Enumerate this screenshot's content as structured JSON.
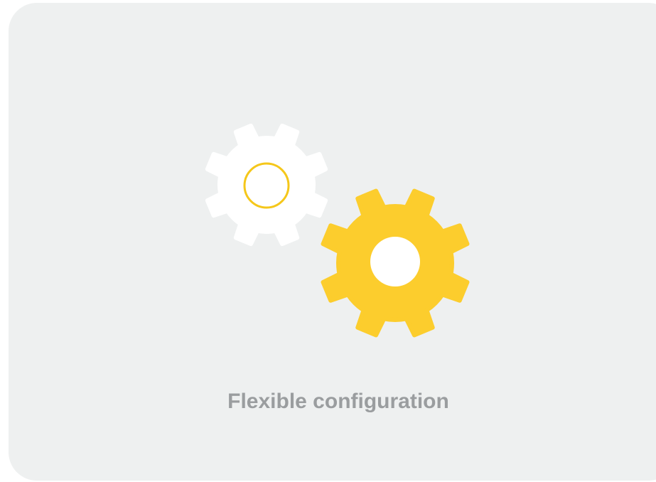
{
  "feature": {
    "caption": "Flexible configuration",
    "icon": "settings-gears-icon"
  },
  "colors": {
    "card_background": "#eef0f0",
    "gear_small": "#ffffff",
    "gear_small_ring": "#f5c71a",
    "gear_large": "#fccd2d",
    "gear_large_hub": "#ffffff",
    "caption_text": "#9a9d9f"
  }
}
